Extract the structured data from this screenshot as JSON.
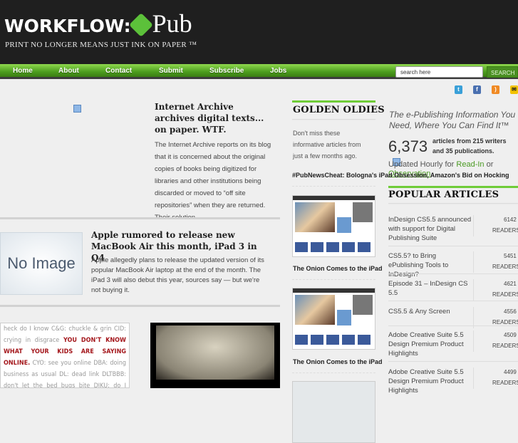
{
  "header": {
    "logo_text": "WORKFLOW:",
    "logo_pub": "Pub",
    "tagline": "PRINT NO LONGER MEANS JUST INK ON PAPER ™"
  },
  "nav": {
    "items": [
      "Home",
      "About",
      "Contact",
      "Submit",
      "Subscribe",
      "Jobs"
    ],
    "search_placeholder": "search here",
    "search_button": "SEARCH"
  },
  "social": [
    "twitter-icon",
    "facebook-icon",
    "rss-icon",
    "mail-icon"
  ],
  "articles": [
    {
      "title": "Internet Archive archives digital texts... on paper. WTF.",
      "excerpt": "The Internet Archive reports on its blog that it is concerned about the original copies of books being digitized for libraries and other institutions being discarded or moved to “off site repositories” when they are returned. Their solution…"
    },
    {
      "title": "Apple rumored to release new MacBook Air this month, iPad 3 in Q4",
      "image_label": "No Image",
      "excerpt": "Apple allegedly plans to release the updated version of its popular MacBook Air laptop at the end of the month. The iPad 3 will also debut this year, sources say — but we're not buying it."
    }
  ],
  "text_image": {
    "before": "heck do I know C&G: chuckle & grin CID: crying in disgrace ",
    "highlight": "YOU DON'T KNOW WHAT YOUR KIDS ARE SAYING ONLINE.",
    "after": " CYO: see you online DBA: doing business as usual DL: dead link DLTBBB: don't let the bed bugs bite DIKU: do I know you? EMFBI: excuse me"
  },
  "golden": {
    "heading": "GOLDEN OLDIES",
    "intro": "Don't miss these informative articles from just a few months ago.",
    "ticker": "#PubNewsCheat: Bologna's iPad Obsession, Amazon's Bid on Hocking",
    "items": [
      "The Onion Comes to the iPad",
      "The Onion Comes to the iPad"
    ]
  },
  "info": {
    "tagline": "The e-Publishing Information You Need, Where You Can Find It™",
    "count": "6,373",
    "count_text": "articles from 215 writers and 35 publications.",
    "updated_prefix": "Updated Hourly for ",
    "link1": "Read-In",
    "or": " or",
    "link2": "Observation"
  },
  "popular": {
    "heading": "POPULAR ARTICLES",
    "readers_label": "READERS",
    "items": [
      {
        "title": "InDesign CS5.5 announced with support for Digital Publishing Suite",
        "count": "6142"
      },
      {
        "title": "CS5.5? to Bring ePublishing Tools to InDesign?",
        "count": "5451"
      },
      {
        "title": "Episode 31 – InDesign CS 5.5",
        "count": "4621"
      },
      {
        "title": "CS5.5 & Any Screen",
        "count": "4556"
      },
      {
        "title": "Adobe Creative Suite 5.5 Design Premium Product Highlights",
        "count": "4509"
      },
      {
        "title": "Adobe Creative Suite 5.5 Design Premium Product Highlights",
        "count": "4499"
      }
    ]
  }
}
